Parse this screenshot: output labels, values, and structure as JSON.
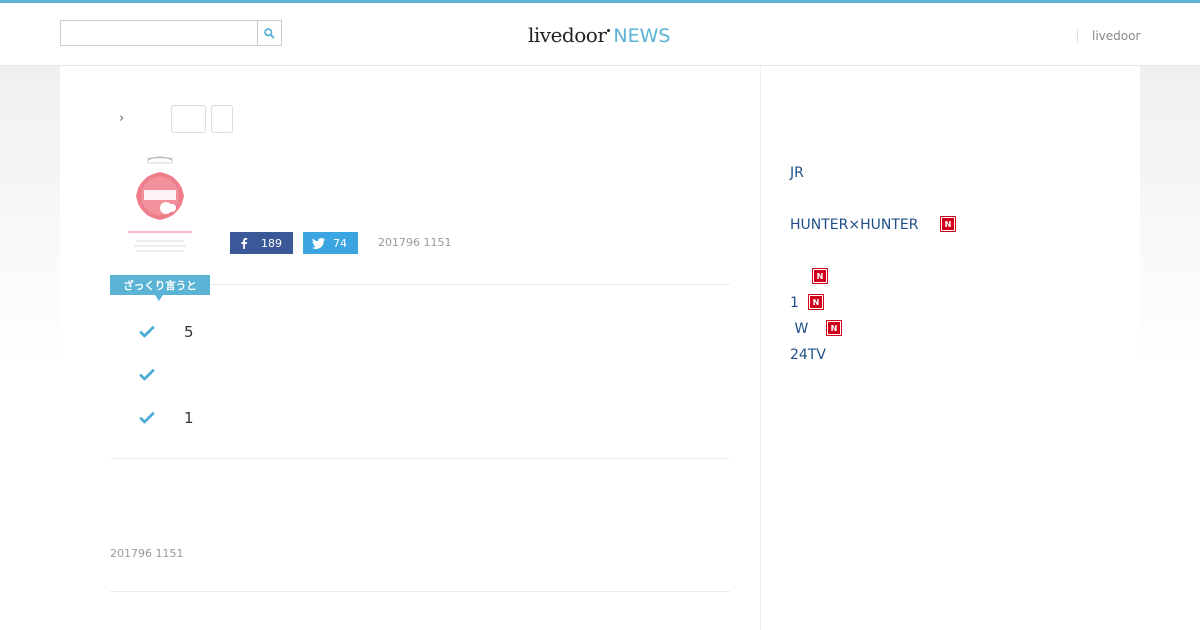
{
  "header": {
    "search": {
      "placeholder": "",
      "value": ""
    },
    "logo": {
      "brand": "livedoor",
      "product": "NEWS"
    },
    "right_link": "livedoor"
  },
  "article": {
    "breadcrumb_arrow": "›",
    "share": {
      "facebook_count": "189",
      "twitter_count": "74"
    },
    "date_top": "201796 1151",
    "summary_label": "ざっくり言うと",
    "points": [
      "5",
      "",
      "1"
    ],
    "date_bottom": "201796 1151"
  },
  "sidebar": {
    "items": [
      {
        "label": "JR",
        "new": false
      },
      {
        "label": "HUNTER×HUNTER",
        "new": true
      },
      {
        "label": "",
        "new": true
      },
      {
        "label": "1",
        "new": true
      },
      {
        "label": " W",
        "new": true
      },
      {
        "label": "24TV",
        "new": false
      }
    ],
    "badge_text": "N"
  },
  "colors": {
    "accent": "#5bb4d6",
    "facebook": "#3b5998",
    "twitter": "#3aa5e0",
    "link": "#1f4f86",
    "new_badge": "#d0021b"
  }
}
